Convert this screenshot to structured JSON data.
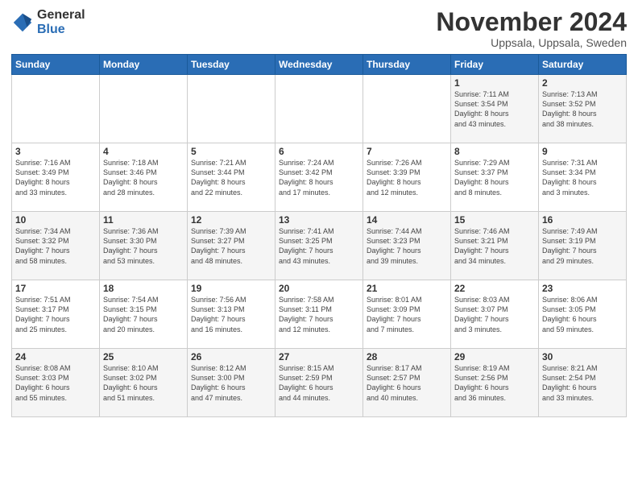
{
  "logo": {
    "general": "General",
    "blue": "Blue"
  },
  "title": "November 2024",
  "location": "Uppsala, Uppsala, Sweden",
  "headers": [
    "Sunday",
    "Monday",
    "Tuesday",
    "Wednesday",
    "Thursday",
    "Friday",
    "Saturday"
  ],
  "weeks": [
    [
      {
        "day": "",
        "info": ""
      },
      {
        "day": "",
        "info": ""
      },
      {
        "day": "",
        "info": ""
      },
      {
        "day": "",
        "info": ""
      },
      {
        "day": "",
        "info": ""
      },
      {
        "day": "1",
        "info": "Sunrise: 7:11 AM\nSunset: 3:54 PM\nDaylight: 8 hours\nand 43 minutes."
      },
      {
        "day": "2",
        "info": "Sunrise: 7:13 AM\nSunset: 3:52 PM\nDaylight: 8 hours\nand 38 minutes."
      }
    ],
    [
      {
        "day": "3",
        "info": "Sunrise: 7:16 AM\nSunset: 3:49 PM\nDaylight: 8 hours\nand 33 minutes."
      },
      {
        "day": "4",
        "info": "Sunrise: 7:18 AM\nSunset: 3:46 PM\nDaylight: 8 hours\nand 28 minutes."
      },
      {
        "day": "5",
        "info": "Sunrise: 7:21 AM\nSunset: 3:44 PM\nDaylight: 8 hours\nand 22 minutes."
      },
      {
        "day": "6",
        "info": "Sunrise: 7:24 AM\nSunset: 3:42 PM\nDaylight: 8 hours\nand 17 minutes."
      },
      {
        "day": "7",
        "info": "Sunrise: 7:26 AM\nSunset: 3:39 PM\nDaylight: 8 hours\nand 12 minutes."
      },
      {
        "day": "8",
        "info": "Sunrise: 7:29 AM\nSunset: 3:37 PM\nDaylight: 8 hours\nand 8 minutes."
      },
      {
        "day": "9",
        "info": "Sunrise: 7:31 AM\nSunset: 3:34 PM\nDaylight: 8 hours\nand 3 minutes."
      }
    ],
    [
      {
        "day": "10",
        "info": "Sunrise: 7:34 AM\nSunset: 3:32 PM\nDaylight: 7 hours\nand 58 minutes."
      },
      {
        "day": "11",
        "info": "Sunrise: 7:36 AM\nSunset: 3:30 PM\nDaylight: 7 hours\nand 53 minutes."
      },
      {
        "day": "12",
        "info": "Sunrise: 7:39 AM\nSunset: 3:27 PM\nDaylight: 7 hours\nand 48 minutes."
      },
      {
        "day": "13",
        "info": "Sunrise: 7:41 AM\nSunset: 3:25 PM\nDaylight: 7 hours\nand 43 minutes."
      },
      {
        "day": "14",
        "info": "Sunrise: 7:44 AM\nSunset: 3:23 PM\nDaylight: 7 hours\nand 39 minutes."
      },
      {
        "day": "15",
        "info": "Sunrise: 7:46 AM\nSunset: 3:21 PM\nDaylight: 7 hours\nand 34 minutes."
      },
      {
        "day": "16",
        "info": "Sunrise: 7:49 AM\nSunset: 3:19 PM\nDaylight: 7 hours\nand 29 minutes."
      }
    ],
    [
      {
        "day": "17",
        "info": "Sunrise: 7:51 AM\nSunset: 3:17 PM\nDaylight: 7 hours\nand 25 minutes."
      },
      {
        "day": "18",
        "info": "Sunrise: 7:54 AM\nSunset: 3:15 PM\nDaylight: 7 hours\nand 20 minutes."
      },
      {
        "day": "19",
        "info": "Sunrise: 7:56 AM\nSunset: 3:13 PM\nDaylight: 7 hours\nand 16 minutes."
      },
      {
        "day": "20",
        "info": "Sunrise: 7:58 AM\nSunset: 3:11 PM\nDaylight: 7 hours\nand 12 minutes."
      },
      {
        "day": "21",
        "info": "Sunrise: 8:01 AM\nSunset: 3:09 PM\nDaylight: 7 hours\nand 7 minutes."
      },
      {
        "day": "22",
        "info": "Sunrise: 8:03 AM\nSunset: 3:07 PM\nDaylight: 7 hours\nand 3 minutes."
      },
      {
        "day": "23",
        "info": "Sunrise: 8:06 AM\nSunset: 3:05 PM\nDaylight: 6 hours\nand 59 minutes."
      }
    ],
    [
      {
        "day": "24",
        "info": "Sunrise: 8:08 AM\nSunset: 3:03 PM\nDaylight: 6 hours\nand 55 minutes."
      },
      {
        "day": "25",
        "info": "Sunrise: 8:10 AM\nSunset: 3:02 PM\nDaylight: 6 hours\nand 51 minutes."
      },
      {
        "day": "26",
        "info": "Sunrise: 8:12 AM\nSunset: 3:00 PM\nDaylight: 6 hours\nand 47 minutes."
      },
      {
        "day": "27",
        "info": "Sunrise: 8:15 AM\nSunset: 2:59 PM\nDaylight: 6 hours\nand 44 minutes."
      },
      {
        "day": "28",
        "info": "Sunrise: 8:17 AM\nSunset: 2:57 PM\nDaylight: 6 hours\nand 40 minutes."
      },
      {
        "day": "29",
        "info": "Sunrise: 8:19 AM\nSunset: 2:56 PM\nDaylight: 6 hours\nand 36 minutes."
      },
      {
        "day": "30",
        "info": "Sunrise: 8:21 AM\nSunset: 2:54 PM\nDaylight: 6 hours\nand 33 minutes."
      }
    ]
  ]
}
